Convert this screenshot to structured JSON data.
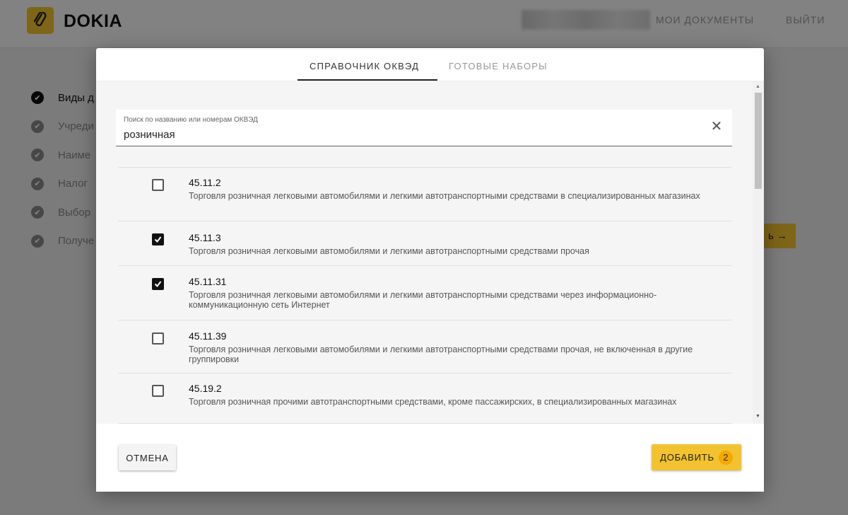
{
  "app": {
    "brand": "DOKIA",
    "nav": {
      "documents": "МОИ ДОКУМЕНТЫ",
      "logout": "ВЫЙТИ"
    }
  },
  "steps": [
    {
      "label": "Виды д",
      "active": true
    },
    {
      "label": "Учреди",
      "active": false
    },
    {
      "label": "Наиме",
      "active": false
    },
    {
      "label": "Налог",
      "active": false
    },
    {
      "label": "Выбор",
      "active": false
    },
    {
      "label": "Получе",
      "active": false
    }
  ],
  "background": {
    "next_label": "ь →"
  },
  "modal": {
    "tabs": [
      {
        "label": "СПРАВОЧНИК ОКВЭД",
        "active": true
      },
      {
        "label": "ГОТОВЫЕ НАБОРЫ",
        "active": false
      }
    ],
    "search": {
      "label": "Поиск по названию или номерам ОКВЭД",
      "value": "розничная",
      "clear_icon": "close-icon"
    },
    "items": [
      {
        "code": "45.11.2",
        "desc": "Торговля розничная легковыми автомобилями и легкими автотранспортными средствами в специализированных магазинах",
        "checked": false
      },
      {
        "code": "45.11.3",
        "desc": "Торговля розничная легковыми автомобилями и легкими автотранспортными средствами прочая",
        "checked": true
      },
      {
        "code": "45.11.31",
        "desc": "Торговля розничная легковыми автомобилями и легкими автотранспортными средствами через информационно-коммуникационную сеть Интернет",
        "checked": true
      },
      {
        "code": "45.11.39",
        "desc": "Торговля розничная легковыми автомобилями и легкими автотранспортными средствами прочая, не включенная в другие группировки",
        "checked": false
      },
      {
        "code": "45.19.2",
        "desc": "Торговля розничная прочими автотранспортными средствами, кроме пассажирских, в специализированных магазинах",
        "checked": false
      }
    ],
    "footer": {
      "cancel_label": "ОТМЕНА",
      "add_label": "ДОБАВИТЬ",
      "add_count": "2"
    }
  },
  "colors": {
    "accent": "#f2c230",
    "badge": "#f5a800"
  }
}
